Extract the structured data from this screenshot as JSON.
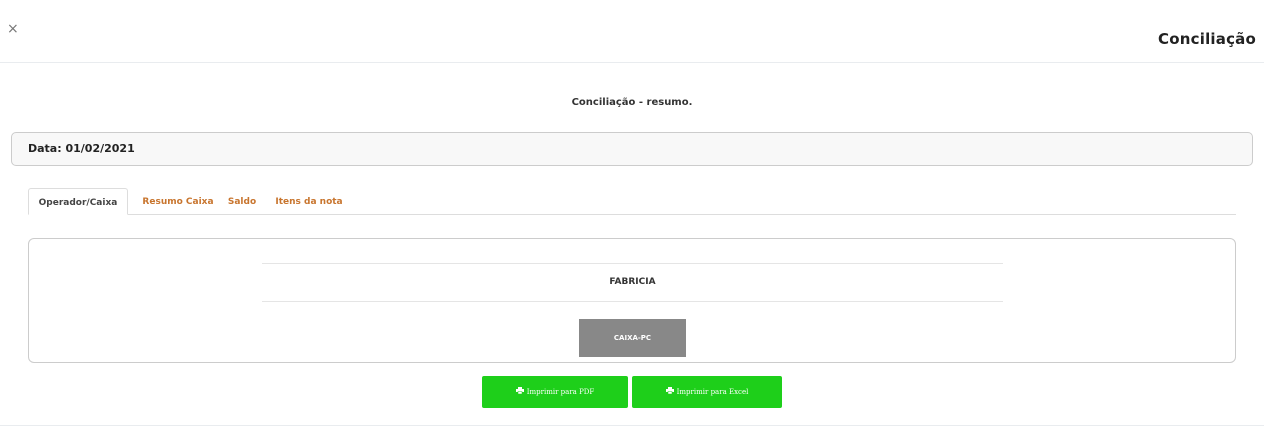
{
  "modal": {
    "close_symbol": "×",
    "title": "Conciliação"
  },
  "summary": {
    "title": "Conciliação - resumo."
  },
  "date_panel": {
    "label": "Data: 01/02/2021"
  },
  "tabs": [
    {
      "label": "Operador/Caixa",
      "active": true
    },
    {
      "label": "Resumo Caixa",
      "active": false
    },
    {
      "label": "Saldo",
      "active": false
    },
    {
      "label": "Itens da nota",
      "active": false
    }
  ],
  "operator": {
    "name": "FABRICIA",
    "caixa_button": "CAIXA-PC"
  },
  "actions": {
    "pdf_icon": "printer-icon",
    "pdf_label": "Imprimir para PDF",
    "excel_icon": "printer-icon",
    "excel_label": "Imprimir para Excel",
    "button_color": "#1ecf1a"
  },
  "colors": {
    "tab_link": "#c8752e",
    "caixa_button": "#888888"
  }
}
